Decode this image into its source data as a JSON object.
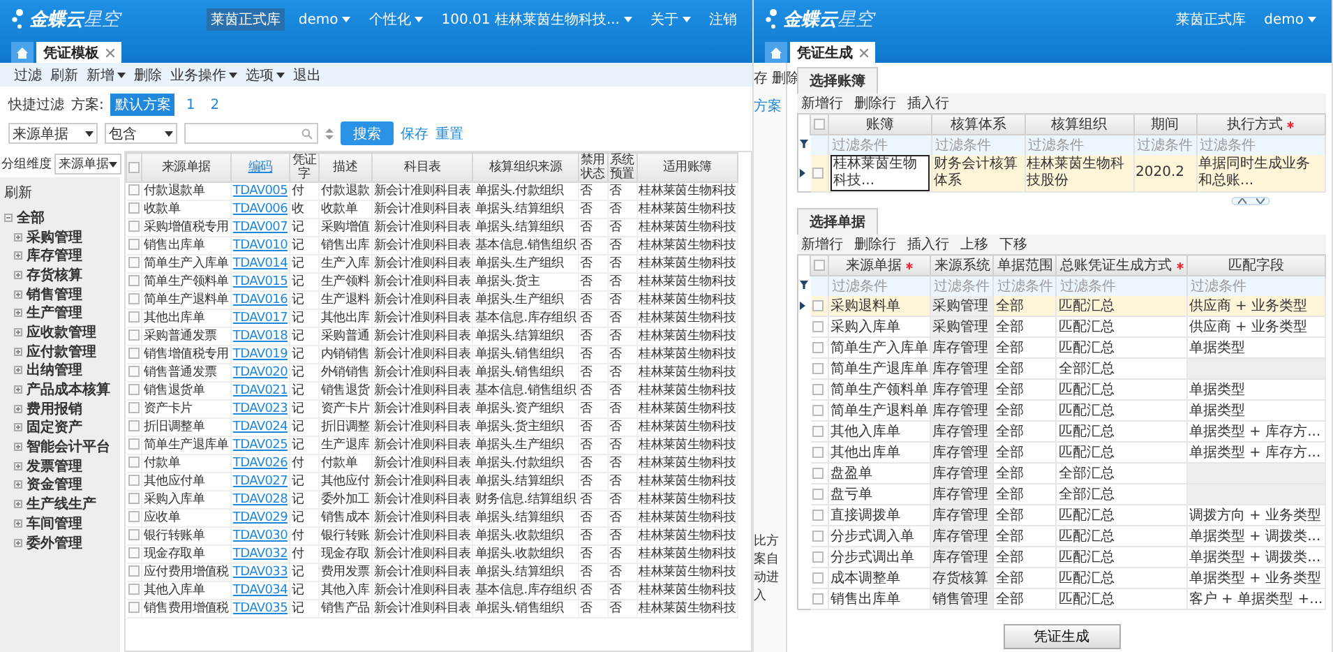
{
  "left_window": {
    "header": {
      "logo": "金蝶云",
      "logo_sub": "星空",
      "menu": [
        {
          "label": "莱茵正式库",
          "dropdown": false,
          "boxed": true
        },
        {
          "label": "demo",
          "dropdown": true,
          "boxed": false
        },
        {
          "label": "个性化",
          "dropdown": true,
          "boxed": false
        },
        {
          "label": "100.01 桂林莱茵生物科技...",
          "dropdown": true,
          "boxed": false
        },
        {
          "label": "关于",
          "dropdown": true,
          "boxed": false
        },
        {
          "label": "注销",
          "dropdown": false,
          "boxed": false
        }
      ]
    },
    "tabs": [
      {
        "label": "凭证模板",
        "selected": true,
        "closable": true
      }
    ],
    "toolbar": [
      {
        "label": "过滤",
        "dropdown": false
      },
      {
        "label": "刷新",
        "dropdown": false
      },
      {
        "label": "新增",
        "dropdown": true
      },
      {
        "label": "删除",
        "dropdown": false
      },
      {
        "label": "业务操作",
        "dropdown": true
      },
      {
        "label": "选项",
        "dropdown": true
      },
      {
        "label": "退出",
        "dropdown": false
      }
    ],
    "quick_filter": {
      "label": "快捷过滤",
      "scheme_label": "方案:",
      "schemes": [
        {
          "label": "默认方案",
          "selected": true
        },
        {
          "label": "1",
          "selected": false
        },
        {
          "label": "2",
          "selected": false
        }
      ]
    },
    "search": {
      "field": "来源单据",
      "operator": "包含",
      "button": "搜索",
      "links": [
        "保存",
        "重置"
      ]
    },
    "sidebar": {
      "group_label": "分组维度",
      "group_value": "来源单据",
      "refresh": "刷新",
      "tree": [
        {
          "label": "全部",
          "expanded": true,
          "children": [
            {
              "label": "采购管理",
              "expanded": false
            },
            {
              "label": "库存管理",
              "expanded": false
            },
            {
              "label": "存货核算",
              "expanded": false
            },
            {
              "label": "销售管理",
              "expanded": false
            },
            {
              "label": "生产管理",
              "expanded": false
            },
            {
              "label": "应收款管理",
              "expanded": false
            },
            {
              "label": "应付款管理",
              "expanded": false
            },
            {
              "label": "出纳管理",
              "expanded": false
            },
            {
              "label": "产品成本核算",
              "expanded": false
            },
            {
              "label": "费用报销",
              "expanded": false
            },
            {
              "label": "固定资产",
              "expanded": false
            },
            {
              "label": "智能会计平台",
              "expanded": false
            },
            {
              "label": "发票管理",
              "expanded": false
            },
            {
              "label": "资金管理",
              "expanded": false
            },
            {
              "label": "生产线生产",
              "expanded": false
            },
            {
              "label": "车间管理",
              "expanded": false
            },
            {
              "label": "委外管理",
              "expanded": false
            }
          ]
        }
      ]
    },
    "table": {
      "all_checked": false,
      "columns": [
        "来源单据",
        "编码",
        "凭证字",
        "描述",
        "科目表",
        "核算组织来源",
        "禁用状态",
        "系统预置",
        "适用账簿"
      ],
      "rows": [
        {
          "checked": false,
          "cells": [
            "付款退款单",
            "TDAV005",
            "付",
            "付款退款",
            "新会计准则科目表",
            "单据头.付款组织",
            "否",
            "否",
            "桂林莱茵生物科技"
          ]
        },
        {
          "checked": false,
          "cells": [
            "收款单",
            "TDAV006",
            "收",
            "收款单",
            "新会计准则科目表",
            "单据头.结算组织",
            "否",
            "否",
            "桂林莱茵生物科技"
          ]
        },
        {
          "checked": false,
          "cells": [
            "采购增值税专用",
            "TDAV007",
            "记",
            "采购增值",
            "新会计准则科目表",
            "单据头.结算组织",
            "否",
            "否",
            "桂林莱茵生物科技"
          ]
        },
        {
          "checked": false,
          "cells": [
            "销售出库单",
            "TDAV010",
            "记",
            "销售出库",
            "新会计准则科目表",
            "基本信息.销售组织",
            "否",
            "否",
            "桂林莱茵生物科技"
          ]
        },
        {
          "checked": false,
          "cells": [
            "简单生产入库单",
            "TDAV014",
            "记",
            "生产入库",
            "新会计准则科目表",
            "单据头.生产组织",
            "否",
            "否",
            "桂林莱茵生物科技"
          ]
        },
        {
          "checked": false,
          "cells": [
            "简单生产领料单",
            "TDAV015",
            "记",
            "生产领料",
            "新会计准则科目表",
            "单据头.货主",
            "否",
            "否",
            "桂林莱茵生物科技"
          ]
        },
        {
          "checked": false,
          "cells": [
            "简单生产退料单",
            "TDAV016",
            "记",
            "生产退料",
            "新会计准则科目表",
            "单据头.生产组织",
            "否",
            "否",
            "桂林莱茵生物科技"
          ]
        },
        {
          "checked": false,
          "cells": [
            "其他出库单",
            "TDAV017",
            "记",
            "其他出库",
            "新会计准则科目表",
            "基本信息.库存组织",
            "否",
            "否",
            "桂林莱茵生物科技"
          ]
        },
        {
          "checked": false,
          "cells": [
            "采购普通发票",
            "TDAV018",
            "记",
            "采购普通",
            "新会计准则科目表",
            "单据头.结算组织",
            "否",
            "否",
            "桂林莱茵生物科技"
          ]
        },
        {
          "checked": false,
          "cells": [
            "销售增值税专用",
            "TDAV019",
            "记",
            "内销销售",
            "新会计准则科目表",
            "单据头.销售组织",
            "否",
            "否",
            "桂林莱茵生物科技"
          ]
        },
        {
          "checked": false,
          "cells": [
            "销售普通发票",
            "TDAV020",
            "记",
            "外销销售",
            "新会计准则科目表",
            "单据头.销售组织",
            "否",
            "否",
            "桂林莱茵生物科技"
          ]
        },
        {
          "checked": false,
          "cells": [
            "销售退货单",
            "TDAV021",
            "记",
            "销售退货",
            "新会计准则科目表",
            "基本信息.销售组织",
            "否",
            "否",
            "桂林莱茵生物科技"
          ]
        },
        {
          "checked": false,
          "cells": [
            "资产卡片",
            "TDAV023",
            "记",
            "资产卡片",
            "新会计准则科目表",
            "单据头.资产组织",
            "否",
            "否",
            "桂林莱茵生物科技"
          ]
        },
        {
          "checked": false,
          "cells": [
            "折旧调整单",
            "TDAV024",
            "记",
            "折旧调整",
            "新会计准则科目表",
            "单据头.货主组织",
            "否",
            "否",
            "桂林莱茵生物科技"
          ]
        },
        {
          "checked": false,
          "cells": [
            "简单生产退库单",
            "TDAV025",
            "记",
            "生产退库",
            "新会计准则科目表",
            "单据头.生产组织",
            "否",
            "否",
            "桂林莱茵生物科技"
          ]
        },
        {
          "checked": false,
          "cells": [
            "付款单",
            "TDAV026",
            "付",
            "付款单",
            "新会计准则科目表",
            "单据头.付款组织",
            "否",
            "否",
            "桂林莱茵生物科技"
          ]
        },
        {
          "checked": false,
          "cells": [
            "其他应付单",
            "TDAV027",
            "记",
            "其他应付",
            "新会计准则科目表",
            "单据头.结算组织",
            "否",
            "否",
            "桂林莱茵生物科技"
          ]
        },
        {
          "checked": false,
          "cells": [
            "采购入库单",
            "TDAV028",
            "记",
            "委外加工",
            "新会计准则科目表",
            "财务信息.结算组织",
            "否",
            "否",
            "桂林莱茵生物科技"
          ]
        },
        {
          "checked": false,
          "cells": [
            "应收单",
            "TDAV029",
            "记",
            "销售成本",
            "新会计准则科目表",
            "单据头.结算组织",
            "否",
            "否",
            "桂林莱茵生物科技"
          ]
        },
        {
          "checked": false,
          "cells": [
            "银行转账单",
            "TDAV030",
            "付",
            "银行转账",
            "新会计准则科目表",
            "单据头.收款组织",
            "否",
            "否",
            "桂林莱茵生物科技"
          ]
        },
        {
          "checked": false,
          "cells": [
            "现金存取单",
            "TDAV032",
            "付",
            "现金存取",
            "新会计准则科目表",
            "单据头.收款组织",
            "否",
            "否",
            "桂林莱茵生物科技"
          ]
        },
        {
          "checked": false,
          "cells": [
            "应付费用增值税",
            "TDAV033",
            "记",
            "费用发票",
            "新会计准则科目表",
            "单据头.结算组织",
            "否",
            "否",
            "桂林莱茵生物科技"
          ]
        },
        {
          "checked": false,
          "cells": [
            "其他入库单",
            "TDAV034",
            "记",
            "其他入库",
            "新会计准则科目表",
            "基本信息.库存组织",
            "否",
            "否",
            "桂林莱茵生物科技"
          ]
        },
        {
          "checked": false,
          "cells": [
            "销售费用增值税",
            "TDAV035",
            "记",
            "销售产品",
            "新会计准则科目表",
            "单据头.销售组织",
            "否",
            "否",
            "桂林莱茵生物科技"
          ]
        }
      ]
    }
  },
  "right_window": {
    "header": {
      "logo": "金蝶云",
      "logo_sub": "星空",
      "menu": [
        {
          "label": "莱茵正式库",
          "dropdown": false,
          "boxed": false
        },
        {
          "label": "demo",
          "dropdown": true,
          "boxed": false
        }
      ]
    },
    "tabs": [
      {
        "label": "凭证生成",
        "selected": true,
        "closable": true
      }
    ],
    "side_panel": {
      "toolbar": [
        "存",
        "删除"
      ],
      "link": "方案",
      "note": "比方案自动进入"
    },
    "ledger_section": {
      "title": "选择账簿",
      "toolbar": [
        "新增行",
        "删除行",
        "插入行"
      ],
      "all_checked": false,
      "columns": [
        {
          "label": "账簿",
          "required": false
        },
        {
          "label": "核算体系",
          "required": false
        },
        {
          "label": "核算组织",
          "required": false
        },
        {
          "label": "期间",
          "required": false
        },
        {
          "label": "执行方式",
          "required": true
        }
      ],
      "filters": [
        "过滤条件",
        "过滤条件",
        "过滤条件",
        "过滤条件",
        "过滤条件"
      ],
      "rows": [
        {
          "selected": true,
          "checked": false,
          "cells": [
            "桂林莱茵生物科技...",
            "财务会计核算体系",
            "桂林莱茵生物科技股份",
            "2020.2",
            "单据同时生成业务和总账..."
          ]
        }
      ]
    },
    "bill_section": {
      "title": "选择单据",
      "toolbar": [
        "新增行",
        "删除行",
        "插入行",
        "上移",
        "下移"
      ],
      "all_checked": false,
      "columns": [
        {
          "label": "来源单据",
          "required": true
        },
        {
          "label": "来源系统",
          "required": false
        },
        {
          "label": "单据范围",
          "required": false
        },
        {
          "label": "总账凭证生成方式",
          "required": true
        },
        {
          "label": "匹配字段",
          "required": false
        }
      ],
      "filters": [
        "过滤条件",
        "过滤条件",
        "过滤条件",
        "过滤条件",
        "过滤条件"
      ],
      "rows": [
        {
          "selected": true,
          "checked": false,
          "source": "采购退料单",
          "system": "采购管理",
          "range": "全部",
          "mode": "匹配汇总",
          "match": "供应商 + 业务类型"
        },
        {
          "selected": false,
          "checked": false,
          "source": "采购入库单",
          "system": "采购管理",
          "range": "全部",
          "mode": "匹配汇总",
          "match": "供应商 + 业务类型"
        },
        {
          "selected": false,
          "checked": false,
          "source": "简单生产入库单",
          "system": "库存管理",
          "range": "全部",
          "mode": "匹配汇总",
          "match": "单据类型"
        },
        {
          "selected": false,
          "checked": false,
          "source": "简单生产退库单",
          "system": "库存管理",
          "range": "全部",
          "mode": "全部汇总"
        },
        {
          "selected": false,
          "checked": false,
          "source": "简单生产领料单",
          "system": "库存管理",
          "range": "全部",
          "mode": "匹配汇总",
          "match": "单据类型"
        },
        {
          "selected": false,
          "checked": false,
          "source": "简单生产退料单",
          "system": "库存管理",
          "range": "全部",
          "mode": "匹配汇总",
          "match": "单据类型"
        },
        {
          "selected": false,
          "checked": false,
          "source": "其他入库单",
          "system": "库存管理",
          "range": "全部",
          "mode": "匹配汇总",
          "match": "单据类型 + 库存方..."
        },
        {
          "selected": false,
          "checked": false,
          "source": "其他出库单",
          "system": "库存管理",
          "range": "全部",
          "mode": "匹配汇总",
          "match": "单据类型 + 库存方..."
        },
        {
          "selected": false,
          "checked": false,
          "source": "盘盈单",
          "system": "库存管理",
          "range": "全部",
          "mode": "全部汇总"
        },
        {
          "selected": false,
          "checked": false,
          "source": "盘亏单",
          "system": "库存管理",
          "range": "全部",
          "mode": "全部汇总"
        },
        {
          "selected": false,
          "checked": false,
          "source": "直接调拨单",
          "system": "库存管理",
          "range": "全部",
          "mode": "匹配汇总",
          "match": "调拨方向 + 业务类型"
        },
        {
          "selected": false,
          "checked": false,
          "source": "分步式调入单",
          "system": "库存管理",
          "range": "全部",
          "mode": "匹配汇总",
          "match": "单据类型 + 调拨类..."
        },
        {
          "selected": false,
          "checked": false,
          "source": "分步式调出单",
          "system": "库存管理",
          "range": "全部",
          "mode": "匹配汇总",
          "match": "单据类型 + 调拨类..."
        },
        {
          "selected": false,
          "checked": false,
          "source": "成本调整单",
          "system": "存货核算",
          "range": "全部",
          "mode": "匹配汇总",
          "match": "单据类型 + 业务类型"
        },
        {
          "selected": false,
          "checked": false,
          "source": "销售出库单",
          "system": "销售管理",
          "range": "全部",
          "mode": "匹配汇总",
          "match": "客户 + 单据类型 +..."
        }
      ]
    },
    "generate_button": "凭证生成"
  }
}
